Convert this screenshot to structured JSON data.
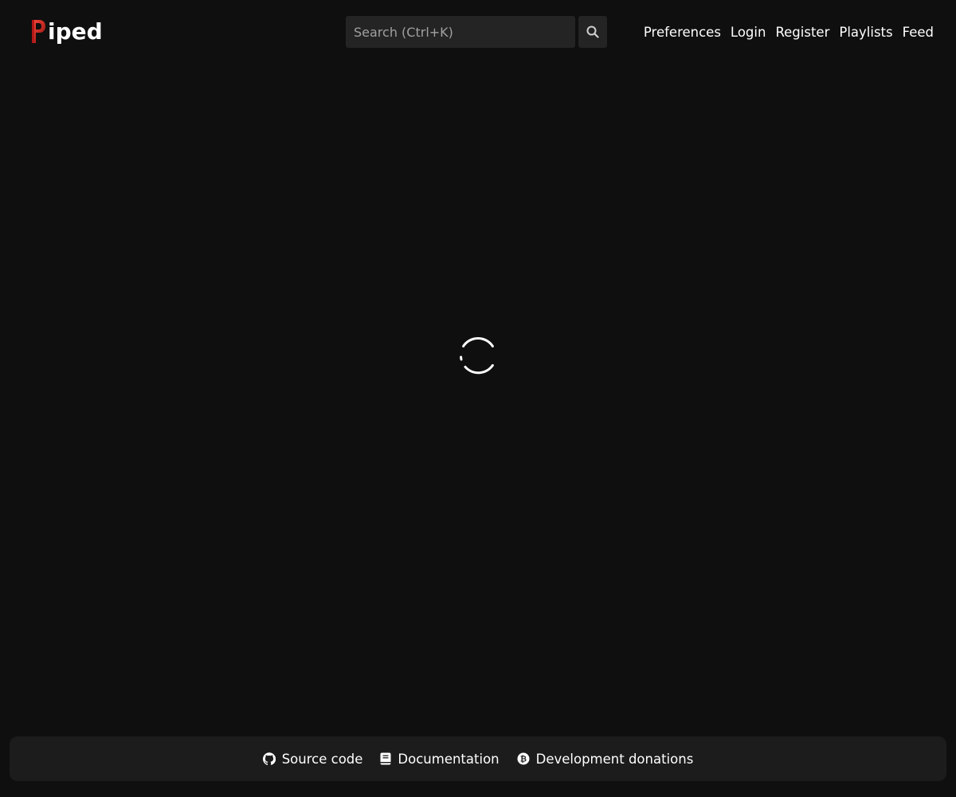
{
  "header": {
    "logo_text": "iped",
    "logo_letter": "P"
  },
  "search": {
    "placeholder": "Search (Ctrl+K)",
    "value": ""
  },
  "nav": {
    "items": [
      {
        "label": "Preferences"
      },
      {
        "label": "Login"
      },
      {
        "label": "Register"
      },
      {
        "label": "Playlists"
      },
      {
        "label": "Feed"
      }
    ]
  },
  "footer": {
    "links": [
      {
        "label": "Source code",
        "icon": "github-icon"
      },
      {
        "label": "Documentation",
        "icon": "book-icon"
      },
      {
        "label": "Development donations",
        "icon": "bitcoin-icon"
      }
    ]
  },
  "colors": {
    "background": "#0f0f0f",
    "surface": "#242424",
    "footer": "#1c1c1c",
    "brand_red": "#d92525"
  }
}
